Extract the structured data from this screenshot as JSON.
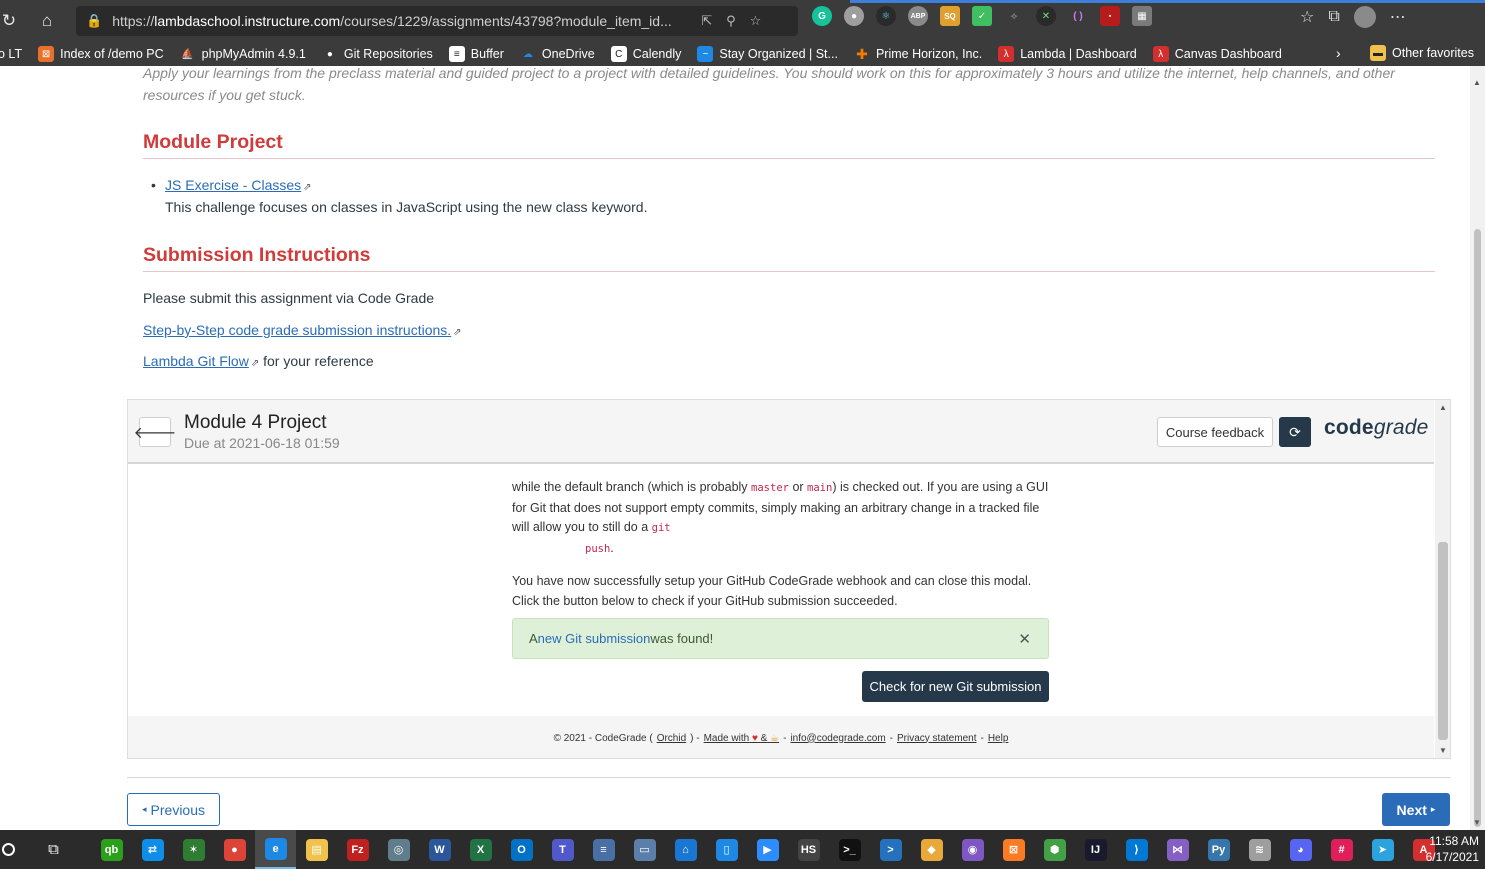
{
  "browser": {
    "url_prefix": "https://",
    "url_host": "lambdaschool.instructure.com",
    "url_path": "/courses/1229/assignments/43798?module_item_id...",
    "bookmarks": [
      {
        "label": "o LT",
        "color": "#3b3b3b"
      },
      {
        "label": "Index of /demo PC",
        "color": "#e8702a"
      },
      {
        "label": "phpMyAdmin 4.9.1",
        "color": "#f29111"
      },
      {
        "label": "Git Repositories",
        "color": "#ffffff"
      },
      {
        "label": "Buffer",
        "color": "#ffffff"
      },
      {
        "label": "OneDrive",
        "color": "#1e88e5"
      },
      {
        "label": "Calendly",
        "color": "#ffffff"
      },
      {
        "label": "Stay Organized | St...",
        "color": "#1e88e5"
      },
      {
        "label": "Prime Horizon, Inc.",
        "color": "#f57c00"
      },
      {
        "label": "Lambda | Dashboard",
        "color": "#d32f2f"
      },
      {
        "label": "Canvas Dashboard",
        "color": "#d32f2f"
      }
    ],
    "other_favorites": "Other favorites"
  },
  "page": {
    "intro_text": "Apply your learnings from the preclass material and guided project to a project with detailed guidelines. You should work on this for approximately 3 hours and utilize the internet, help channels, and other resources if you get stuck.",
    "module_project_heading": "Module Project",
    "exercise_link": "JS Exercise - Classes",
    "exercise_desc": "This challenge focuses on classes in JavaScript using the new class keyword.",
    "submission_heading": "Submission Instructions",
    "submit_text": "Please submit this assignment via Code Grade",
    "step_link": "Step-by-Step code grade submission instructions.",
    "gitflow_link": "Lambda Git Flow",
    "gitflow_suffix": " for your reference",
    "previous_label": "Previous",
    "next_label": "Next"
  },
  "codegrade": {
    "title": "Module 4 Project",
    "due": "Due at 2021-06-18 01:59",
    "feedback_label": "Course feedback",
    "logo_code": "code",
    "logo_grade": "grade",
    "p1_a": "while the default branch (which is probably ",
    "code_master": "master",
    "p1_or": " or ",
    "code_main": "main",
    "p1_b": ") is checked out. If you are using a GUI for Git that does not support empty commits, simply making an arbitrary change in a tracked file will allow you to still do a ",
    "code_git": "git",
    "code_push": "push",
    "p1_end": ".",
    "p2": "You have now successfully setup your GitHub CodeGrade webhook and can close this modal. Click the button below to check if your GitHub submission succeeded.",
    "alert_prefix": "A ",
    "alert_link": "new Git submission",
    "alert_suffix": " was found!",
    "check_button": "Check for new Git submission",
    "footer": {
      "copyright": "© 2021 - CodeGrade (",
      "orchid": "Orchid",
      "close_paren": ") - ",
      "made_with": "Made with",
      "amp": "&",
      "dash": " - ",
      "email": "info@codegrade.com",
      "privacy": "Privacy statement",
      "help": "Help"
    }
  },
  "taskbar": {
    "time": "11:58 AM",
    "date": "6/17/2021",
    "apps": [
      {
        "name": "quickbooks",
        "color": "#2ca01c",
        "glyph": "qb"
      },
      {
        "name": "teamviewer",
        "color": "#0e8ee9",
        "glyph": "⇄"
      },
      {
        "name": "app-green",
        "color": "#2e7d32",
        "glyph": "✶"
      },
      {
        "name": "chrome",
        "color": "#db4437",
        "glyph": "●"
      },
      {
        "name": "edge",
        "color": "#1e88e5",
        "glyph": "e"
      },
      {
        "name": "file-explorer",
        "color": "#f0c24b",
        "glyph": "▤"
      },
      {
        "name": "filezilla",
        "color": "#bf2020",
        "glyph": "Fz"
      },
      {
        "name": "app-satellite",
        "color": "#607d8b",
        "glyph": "◎"
      },
      {
        "name": "word",
        "color": "#2b579a",
        "glyph": "W"
      },
      {
        "name": "excel",
        "color": "#217346",
        "glyph": "X"
      },
      {
        "name": "outlook",
        "color": "#0072c6",
        "glyph": "O"
      },
      {
        "name": "teams",
        "color": "#5059c9",
        "glyph": "T"
      },
      {
        "name": "app-doc",
        "color": "#4a6fa5",
        "glyph": "≡"
      },
      {
        "name": "app-monitor",
        "color": "#5b7fa8",
        "glyph": "▭"
      },
      {
        "name": "app-blue",
        "color": "#1976d2",
        "glyph": "⌂"
      },
      {
        "name": "app-phone",
        "color": "#1e88e5",
        "glyph": "▯"
      },
      {
        "name": "zoom",
        "color": "#2d8cff",
        "glyph": "▶"
      },
      {
        "name": "hubspot",
        "color": "#444444",
        "glyph": "HS"
      },
      {
        "name": "terminal",
        "color": "#111111",
        "glyph": ">_"
      },
      {
        "name": "powershell",
        "color": "#2671be",
        "glyph": ">"
      },
      {
        "name": "git",
        "color": "#e8a93a",
        "glyph": "◆"
      },
      {
        "name": "app-purple",
        "color": "#7e57c2",
        "glyph": "◉"
      },
      {
        "name": "xampp",
        "color": "#fb7a24",
        "glyph": "⊠"
      },
      {
        "name": "app-cube",
        "color": "#43a047",
        "glyph": "⬢"
      },
      {
        "name": "intellij",
        "color": "#1a1a2e",
        "glyph": "IJ"
      },
      {
        "name": "vscode",
        "color": "#0078d4",
        "glyph": "⟩"
      },
      {
        "name": "visual-studio",
        "color": "#865fc5",
        "glyph": "⋈"
      },
      {
        "name": "python",
        "color": "#3776ab",
        "glyph": "Py"
      },
      {
        "name": "database",
        "color": "#9e9e9e",
        "glyph": "≋"
      },
      {
        "name": "discord",
        "color": "#5865f2",
        "glyph": "◕"
      },
      {
        "name": "slack",
        "color": "#e01e5a",
        "glyph": "#"
      },
      {
        "name": "telegram",
        "color": "#2aa3df",
        "glyph": "➤"
      },
      {
        "name": "acrobat",
        "color": "#d32f2f",
        "glyph": "A"
      }
    ]
  }
}
